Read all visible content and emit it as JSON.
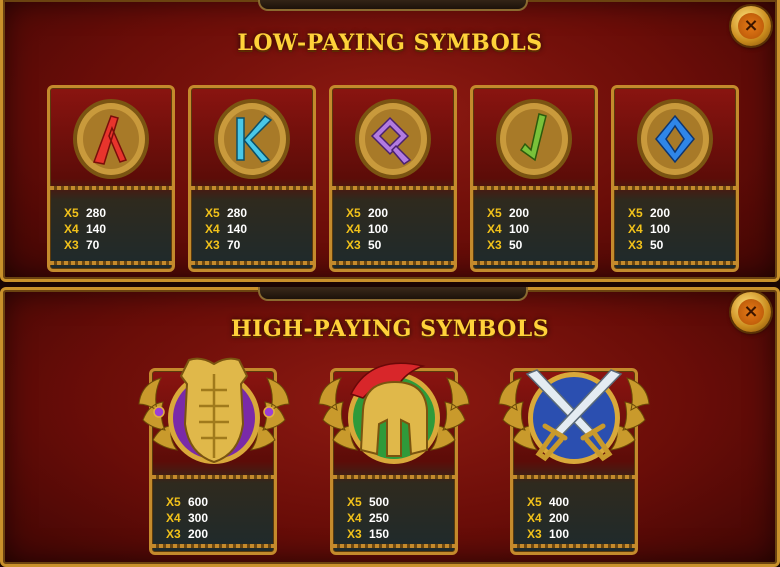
{
  "low_panel": {
    "title": "LOW-PAYING SYMBOLS",
    "close_label": "×",
    "symbols": [
      {
        "name": "lambda-shield",
        "glyph_color": "#e8342c",
        "pays": [
          {
            "mult": "X5",
            "amount": "280"
          },
          {
            "mult": "X4",
            "amount": "140"
          },
          {
            "mult": "X3",
            "amount": "70"
          }
        ]
      },
      {
        "name": "k-shield",
        "glyph_color": "#49c8e8",
        "pays": [
          {
            "mult": "X5",
            "amount": "280"
          },
          {
            "mult": "X4",
            "amount": "140"
          },
          {
            "mult": "X3",
            "amount": "70"
          }
        ]
      },
      {
        "name": "q-shield",
        "glyph_color": "#b27be0",
        "pays": [
          {
            "mult": "X5",
            "amount": "200"
          },
          {
            "mult": "X4",
            "amount": "100"
          },
          {
            "mult": "X3",
            "amount": "50"
          }
        ]
      },
      {
        "name": "j-shield",
        "glyph_color": "#79c23a",
        "pays": [
          {
            "mult": "X5",
            "amount": "200"
          },
          {
            "mult": "X4",
            "amount": "100"
          },
          {
            "mult": "X3",
            "amount": "50"
          }
        ]
      },
      {
        "name": "diamond-shield",
        "glyph_color": "#2f86e8",
        "pays": [
          {
            "mult": "X5",
            "amount": "200"
          },
          {
            "mult": "X4",
            "amount": "100"
          },
          {
            "mult": "X3",
            "amount": "50"
          }
        ]
      }
    ]
  },
  "high_panel": {
    "title": "HIGH-PAYING SYMBOLS",
    "close_label": "×",
    "symbols": [
      {
        "name": "armor",
        "backdrop_color": "#7a2aa8",
        "pays": [
          {
            "mult": "X5",
            "amount": "600"
          },
          {
            "mult": "X4",
            "amount": "300"
          },
          {
            "mult": "X3",
            "amount": "200"
          }
        ]
      },
      {
        "name": "helmet",
        "backdrop_color": "#2f9a3a",
        "pays": [
          {
            "mult": "X5",
            "amount": "500"
          },
          {
            "mult": "X4",
            "amount": "250"
          },
          {
            "mult": "X3",
            "amount": "150"
          }
        ]
      },
      {
        "name": "swords",
        "backdrop_color": "#2b4fb0",
        "pays": [
          {
            "mult": "X5",
            "amount": "400"
          },
          {
            "mult": "X4",
            "amount": "200"
          },
          {
            "mult": "X3",
            "amount": "100"
          }
        ]
      }
    ]
  }
}
